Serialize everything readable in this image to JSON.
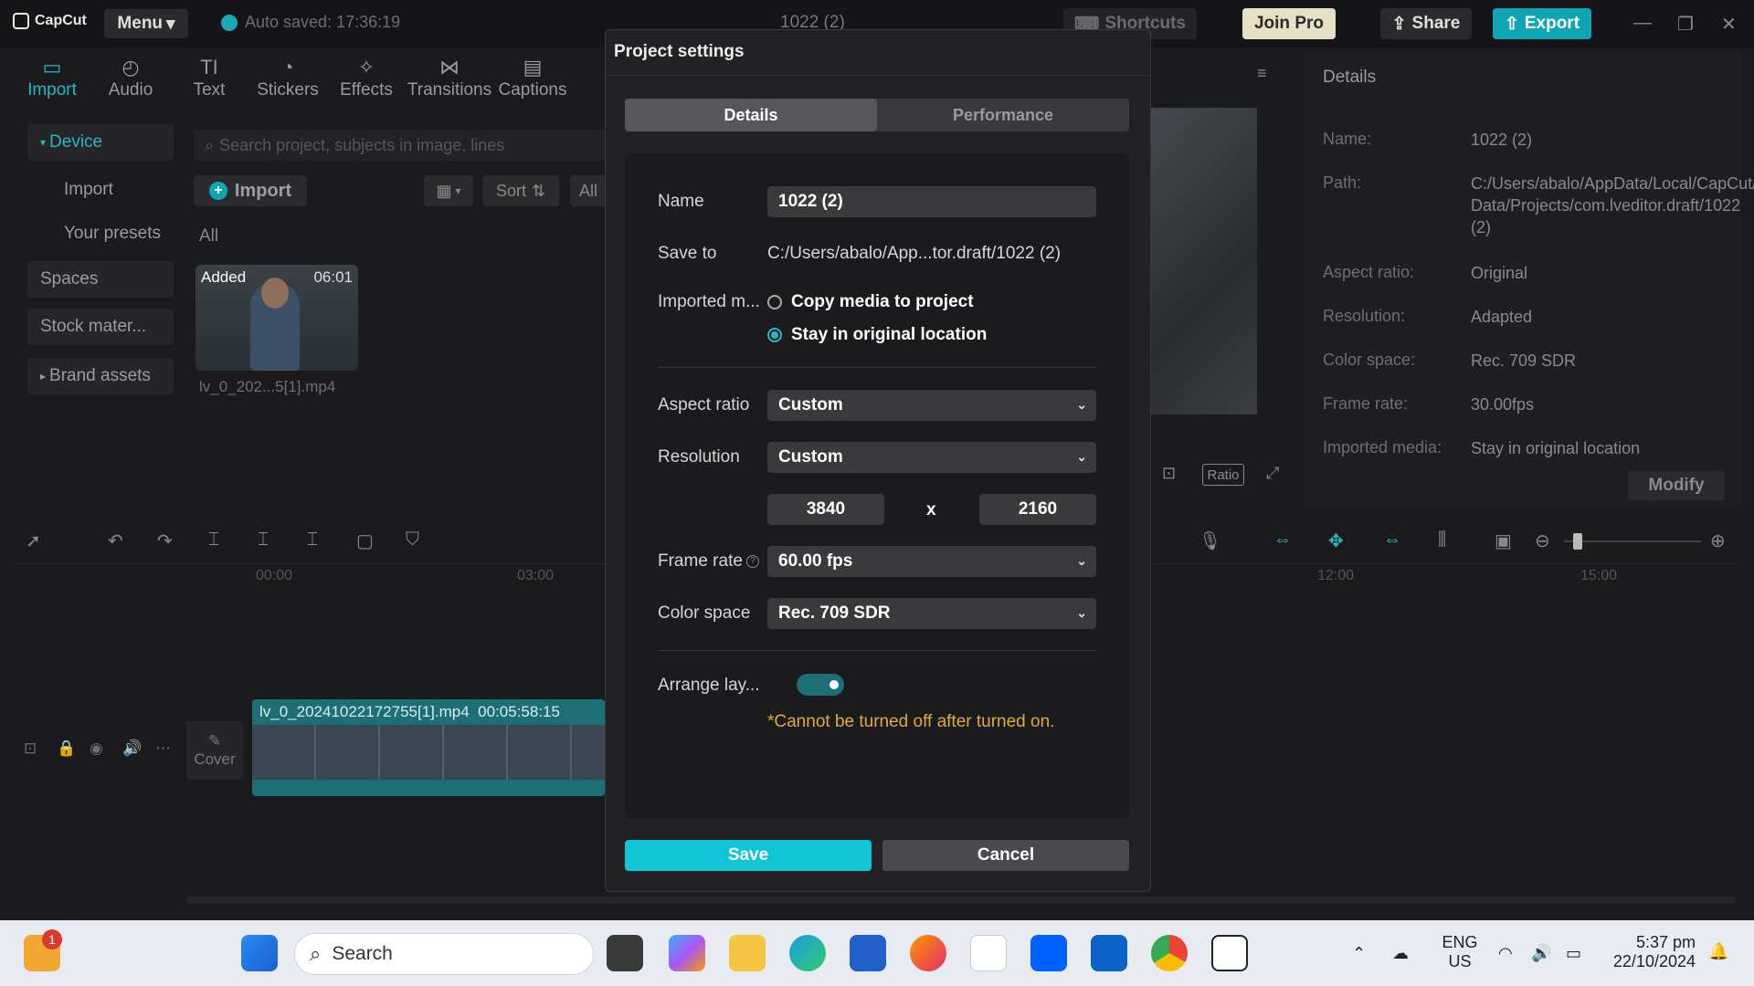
{
  "app": {
    "logo": "CapCut",
    "menu_label": "Menu",
    "autosave": "Auto saved: 17:36:19",
    "project_title": "1022 (2)",
    "shortcuts_label": "Shortcuts",
    "joinpro_label": "Join Pro",
    "share_label": "Share",
    "export_label": "Export"
  },
  "toolbar": {
    "items": [
      {
        "label": "Import",
        "icon": "import-icon"
      },
      {
        "label": "Audio",
        "icon": "audio-icon"
      },
      {
        "label": "Text",
        "icon": "text-icon"
      },
      {
        "label": "Stickers",
        "icon": "stickers-icon"
      },
      {
        "label": "Effects",
        "icon": "effects-icon"
      },
      {
        "label": "Transitions",
        "icon": "transitions-icon"
      },
      {
        "label": "Captions",
        "icon": "captions-icon"
      }
    ]
  },
  "sidebar": {
    "items": [
      "Device",
      "Import",
      "Your presets",
      "Spaces",
      "Stock mater...",
      "Brand assets"
    ]
  },
  "media": {
    "search_placeholder": "Search project, subjects in image, lines",
    "import_label": "Import",
    "sort_label": "Sort",
    "all_filter": "All",
    "all_label": "All",
    "clip": {
      "badge": "Added",
      "duration": "06:01",
      "name": "lv_0_202...5[1].mp4"
    }
  },
  "preview": {
    "ratio_label": "Ratio"
  },
  "details": {
    "title": "Details",
    "rows": [
      {
        "label": "Name:",
        "value": "1022 (2)"
      },
      {
        "label": "Path:",
        "value": "C:/Users/abalo/AppData/Local/CapCut/User Data/Projects/com.lveditor.draft/1022 (2)"
      },
      {
        "label": "Aspect ratio:",
        "value": "Original"
      },
      {
        "label": "Resolution:",
        "value": "Adapted"
      },
      {
        "label": "Color space:",
        "value": "Rec. 709 SDR"
      },
      {
        "label": "Frame rate:",
        "value": "30.00fps"
      },
      {
        "label": "Imported media:",
        "value": "Stay in original location"
      }
    ],
    "modify_label": "Modify"
  },
  "timeline": {
    "ruler": [
      "00:00",
      "03:00",
      "12:00",
      "15:00"
    ],
    "clip_name": "lv_0_20241022172755[1].mp4",
    "clip_duration": "00:05:58:15",
    "cover_label": "Cover"
  },
  "dialog": {
    "title": "Project settings",
    "tabs": [
      "Details",
      "Performance"
    ],
    "name_label": "Name",
    "name_value": "1022 (2)",
    "saveto_label": "Save to",
    "saveto_value": "C:/Users/abalo/App...tor.draft/1022 (2)",
    "imported_label": "Imported m...",
    "imported_options": [
      "Copy media to project",
      "Stay in original location"
    ],
    "aspect_label": "Aspect ratio",
    "aspect_value": "Custom",
    "resolution_label": "Resolution",
    "resolution_value": "Custom",
    "res_width": "3840",
    "res_height": "2160",
    "res_x": "x",
    "framerate_label": "Frame rate",
    "framerate_value": "60.00 fps",
    "colorspace_label": "Color space",
    "colorspace_value": "Rec. 709 SDR",
    "arrange_label": "Arrange lay...",
    "warning": "*Cannot be turned off after turned on.",
    "save_label": "Save",
    "cancel_label": "Cancel"
  },
  "taskbar": {
    "search_label": "Search",
    "notification_count": "1",
    "lang_line1": "ENG",
    "lang_line2": "US",
    "time": "5:37 pm",
    "date": "22/10/2024"
  },
  "colors": {
    "accent": "#0ea5b4",
    "save_button": "#11c4d6",
    "warning": "#e2a93b"
  }
}
